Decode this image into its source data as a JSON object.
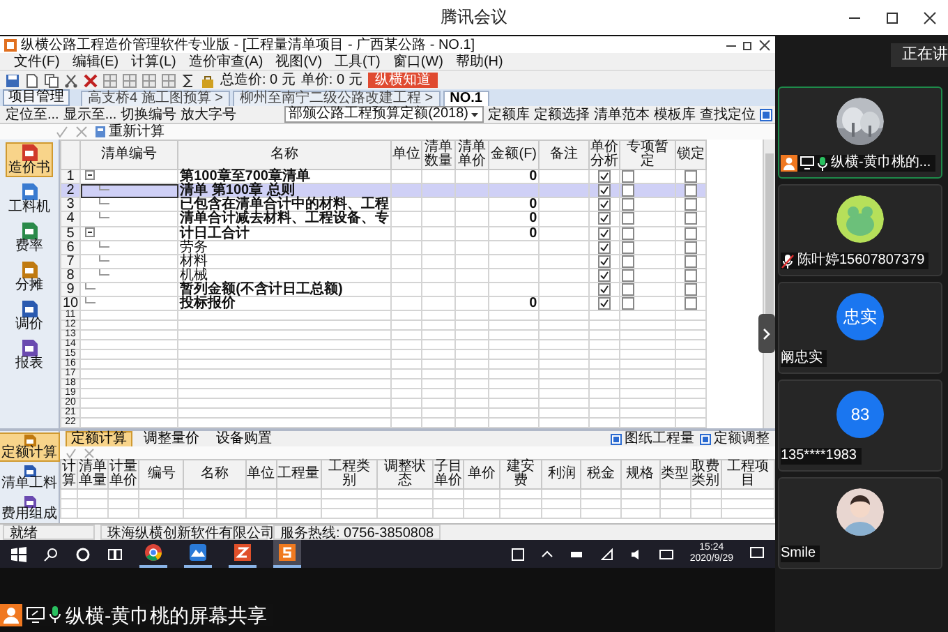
{
  "meeting": {
    "title": "腾讯会议",
    "speaking_label": "正在讲"
  },
  "app": {
    "title": "纵横公路工程造价管理软件专业版 - [工程量清单项目 - 广西某公路 - NO.1]",
    "menu": [
      "文件(F)",
      "编辑(E)",
      "计算(L)",
      "造价审查(A)",
      "视图(V)",
      "工具(T)",
      "窗口(W)",
      "帮助(H)"
    ],
    "total_cost": "总造价: 0 元",
    "unit_price": "单价: 0 元",
    "help_button": "纵横知道",
    "project_button": "项目管理",
    "tabs": [
      {
        "label": "高支桥4 施工图预算 >",
        "selected": false
      },
      {
        "label": "柳州至南宁二级公路改建工程 >",
        "selected": false
      },
      {
        "label": "NO.1",
        "selected": true
      }
    ],
    "locate_buttons": [
      "定位至...",
      "显示至...",
      "切换编号",
      "放大字号"
    ],
    "quota_select": "部颁公路工程预算定额(2018)",
    "quota_buttons": [
      "定额库",
      "定额选择",
      "清单范本",
      "模板库",
      "查找定位"
    ],
    "recalc_button": "重新计算",
    "sidebar": [
      {
        "label": "造价书",
        "selected": true
      },
      {
        "label": "工料机",
        "selected": false
      },
      {
        "label": "费率",
        "selected": false
      },
      {
        "label": "分摊",
        "selected": false
      },
      {
        "label": "调价",
        "selected": false
      },
      {
        "label": "报表",
        "selected": false
      }
    ],
    "bill_table": {
      "columns": [
        "清单编号",
        "名称",
        "单位",
        "清单数量",
        "清单单价",
        "金额(F)",
        "备注",
        "单价分析",
        "专项暂定",
        "锁定"
      ],
      "rows": [
        {
          "kind": "item",
          "no": "1",
          "name": "第100章至700章清单",
          "amount": "0",
          "bold": true,
          "selected": false,
          "unit_analysis": true,
          "special": false,
          "locked": false,
          "expanded": true,
          "children": [
            {
              "kind": "item",
              "no": "2",
              "name": "清单 第100章 总则",
              "bold": true,
              "selected": true,
              "unit_analysis": true,
              "special": false,
              "locked": false
            },
            {
              "kind": "item",
              "no": "3",
              "name": "已包含在清单合计中的材料、工程",
              "amount": "0",
              "bold": true,
              "selected": false,
              "unit_analysis": true,
              "special": false,
              "locked": false
            },
            {
              "kind": "item",
              "no": "4",
              "name": "清单合计减去材料、工程设备、专",
              "amount": "0",
              "bold": true,
              "selected": false,
              "unit_analysis": true,
              "special": false,
              "locked": false
            }
          ]
        },
        {
          "kind": "item",
          "no": "5",
          "name": "计日工合计",
          "amount": "0",
          "bold": true,
          "selected": false,
          "unit_analysis": true,
          "special": false,
          "locked": false,
          "expanded": true,
          "children": [
            {
              "kind": "item",
              "no": "6",
              "name": "劳务",
              "bold": false,
              "selected": false,
              "unit_analysis": true,
              "special": false,
              "locked": false
            },
            {
              "kind": "item",
              "no": "7",
              "name": "材料",
              "bold": false,
              "selected": false,
              "unit_analysis": true,
              "special": false,
              "locked": false
            },
            {
              "kind": "item",
              "no": "8",
              "name": "机械",
              "bold": false,
              "selected": false,
              "unit_analysis": true,
              "special": false,
              "locked": false
            }
          ]
        },
        {
          "kind": "item",
          "no": "9",
          "name": "暂列金额(不含计日工总额)",
          "bold": true,
          "selected": false,
          "unit_analysis": true,
          "special": false,
          "locked": false
        },
        {
          "kind": "item",
          "no": "10",
          "name": "投标报价",
          "amount": "0",
          "bold": true,
          "selected": false,
          "unit_analysis": true,
          "special": false,
          "locked": false
        },
        {
          "kind": "empty",
          "no": "11"
        },
        {
          "kind": "empty",
          "no": "12"
        },
        {
          "kind": "empty",
          "no": "13"
        },
        {
          "kind": "empty",
          "no": "14"
        },
        {
          "kind": "empty",
          "no": "15"
        },
        {
          "kind": "empty",
          "no": "16"
        },
        {
          "kind": "empty",
          "no": "17"
        },
        {
          "kind": "empty",
          "no": "18"
        },
        {
          "kind": "empty",
          "no": "19"
        },
        {
          "kind": "empty",
          "no": "20"
        },
        {
          "kind": "empty",
          "no": "21"
        },
        {
          "kind": "empty",
          "no": "22"
        }
      ]
    },
    "lower_tabs": [
      {
        "label": "定额计算",
        "selected": true
      },
      {
        "label": "调整量价",
        "selected": false
      },
      {
        "label": "设备购置",
        "selected": false
      }
    ],
    "lower_buttons": [
      "图纸工程量",
      "定额调整"
    ],
    "lower_sidebar": [
      {
        "label": "定额计算",
        "selected": true
      },
      {
        "label": "清单工料",
        "selected": false
      },
      {
        "label": "费用组成",
        "selected": false
      }
    ],
    "quota_table": {
      "columns": [
        "计算",
        "清单单量",
        "计量单价",
        "编号",
        "名称",
        "单位",
        "工程量",
        "工程类别",
        "调整状态",
        "子目单价",
        "单价",
        "建安费",
        "利润",
        "税金",
        "规格",
        "类型",
        "取费类别",
        "工程项目"
      ]
    },
    "status_bar": [
      "就绪",
      "珠海纵横创新软件有限公司",
      "服务热线: 0756-3850808"
    ]
  },
  "taskbar": {
    "apps": [
      {
        "kind": "chrome",
        "selected": false
      },
      {
        "kind": "meeting",
        "selected": false
      },
      {
        "kind": "z",
        "selected": false
      },
      {
        "kind": "s",
        "selected": true
      }
    ],
    "time": "15:24",
    "date": "2020/9/29"
  },
  "participants": [
    {
      "kind": "sharer",
      "name": "纵横-黄巾桃的...",
      "speaking": true
    },
    {
      "kind": "muted",
      "name": "陈叶婷15607807379",
      "avatar": {
        "kind": "cartoon"
      },
      "speaking": false
    },
    {
      "kind": "plain",
      "name": "阚忠实",
      "avatar": {
        "kind": "initials",
        "text": "忠实"
      },
      "speaking": false
    },
    {
      "kind": "plain",
      "name": "135****1983",
      "avatar": {
        "kind": "initials",
        "text": "83"
      },
      "speaking": false
    },
    {
      "kind": "plain",
      "name": "Smile",
      "avatar": {
        "kind": "person"
      },
      "speaking": false
    }
  ],
  "sharer_label": "纵横-黄巾桃的屏幕共享"
}
